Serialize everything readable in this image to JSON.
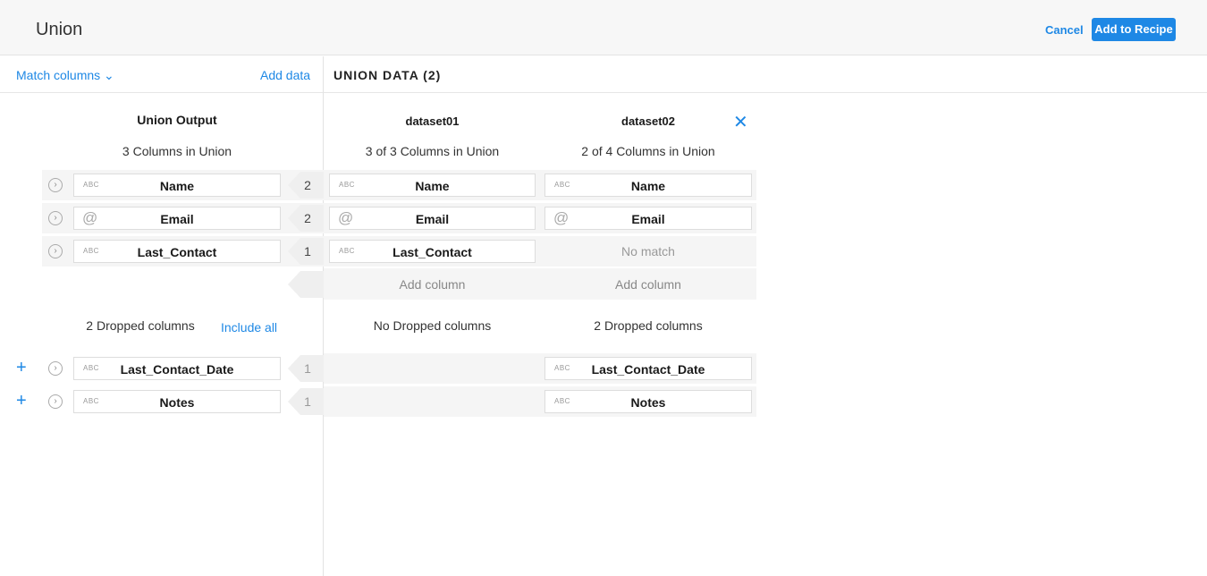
{
  "header": {
    "title": "Union",
    "cancel": "Cancel",
    "add_to_recipe": "Add to Recipe"
  },
  "toolbar": {
    "match_columns": "Match columns ⌄",
    "add_data": "Add data",
    "union_data": "UNION DATA (2)"
  },
  "output": {
    "title": "Union Output",
    "summary": "3 Columns in Union",
    "rows": [
      {
        "label": "Name",
        "icon": "ABC",
        "count": "2"
      },
      {
        "label": "Email",
        "icon": "@",
        "count": "2"
      },
      {
        "label": "Last_Contact",
        "icon": "ABC",
        "count": "1"
      }
    ],
    "dropped_summary": "2 Dropped columns",
    "include_all": "Include all",
    "dropped": [
      {
        "label": "Last_Contact_Date",
        "icon": "ABC",
        "count": "1"
      },
      {
        "label": "Notes",
        "icon": "ABC",
        "count": "1"
      }
    ]
  },
  "datasets": [
    {
      "name": "dataset01",
      "summary": "3 of 3 Columns in Union",
      "cells": [
        "Name",
        "Email",
        "Last_Contact"
      ],
      "add_column": "Add column",
      "dropped_summary": "No Dropped columns"
    },
    {
      "name": "dataset02",
      "summary": "2 of 4 Columns in Union",
      "cells": [
        "Name",
        "Email"
      ],
      "no_match": "No match",
      "add_column": "Add column",
      "dropped_summary": "2 Dropped columns",
      "dropped": [
        "Last_Contact_Date",
        "Notes"
      ]
    }
  ],
  "icons": {
    "abc": "ABC",
    "at": "@",
    "chevron": "›",
    "plus": "+",
    "close": "✕"
  },
  "colors": {
    "accent": "#1e88e5"
  }
}
